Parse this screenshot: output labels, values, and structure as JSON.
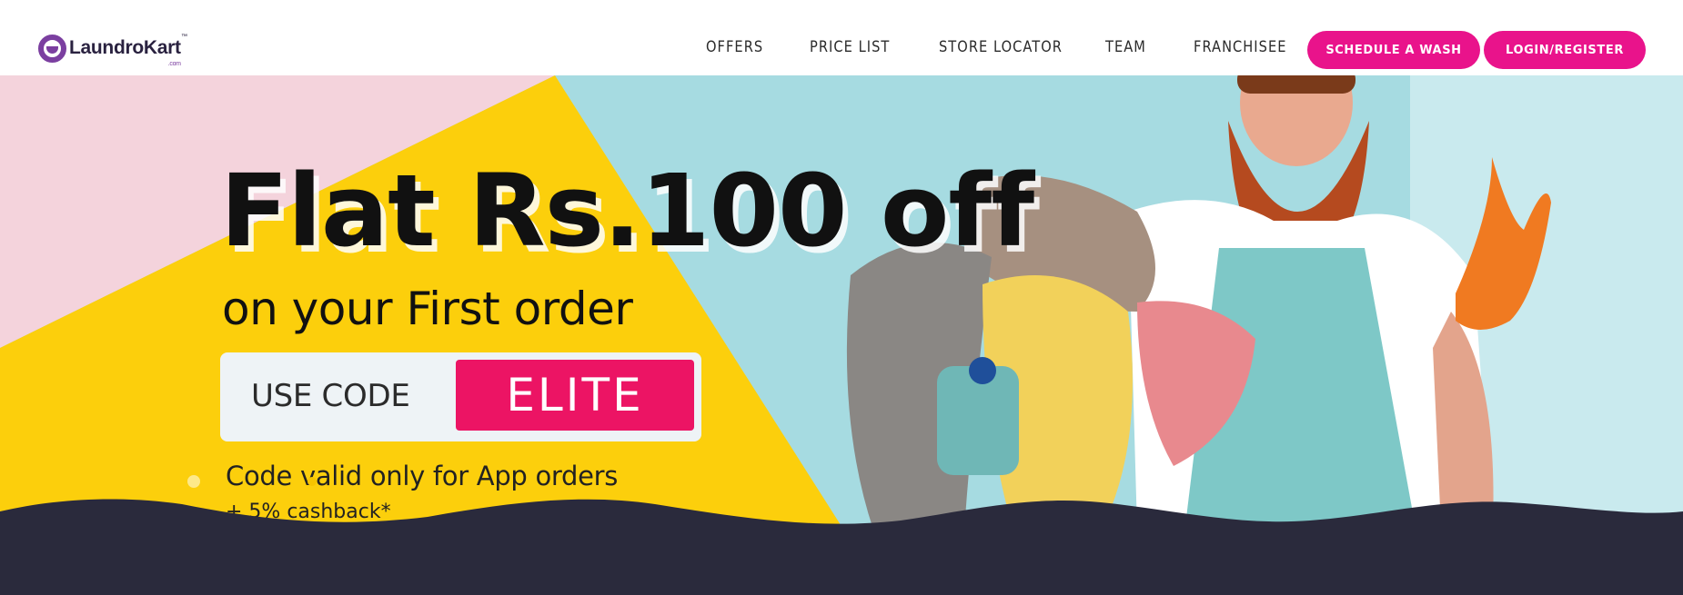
{
  "brand": {
    "name": "LaundroKart",
    "tm": "™",
    "suffix": ".com",
    "color": "#7b3fa0"
  },
  "nav": {
    "links": [
      "OFFERS",
      "PRICE LIST",
      "STORE LOCATOR",
      "TEAM",
      "FRANCHISEE"
    ],
    "schedule_label": "SCHEDULE A WASH",
    "login_label": "LOGIN/REGISTER",
    "button_color": "#e9138b"
  },
  "hero": {
    "headline": "Flat Rs.100 off",
    "subheadline": "on your First order",
    "code_label": "USE CODE",
    "code_value": "ELITE",
    "note": "Code valid only for App orders",
    "note2": "+ 5% cashback*",
    "colors": {
      "pink_bg": "#f4d3dc",
      "yellow_bg": "#fccf0c",
      "teal_bg": "#a6dbe1",
      "code_chip": "#ec1464",
      "footer_band": "#2a2a3c"
    }
  }
}
